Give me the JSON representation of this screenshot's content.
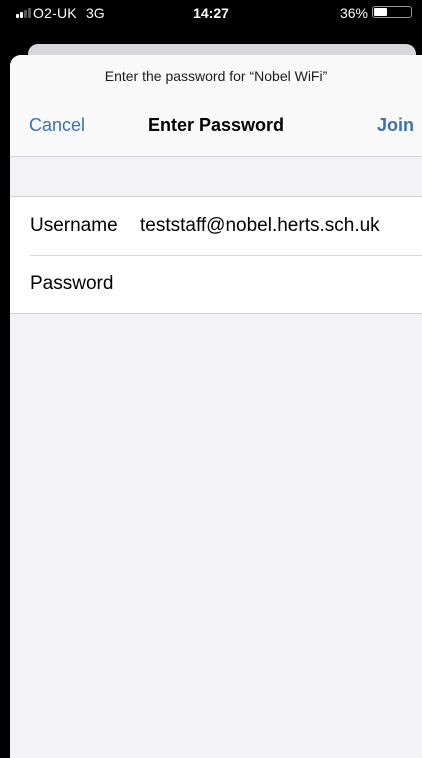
{
  "status_bar": {
    "carrier": "O2-UK",
    "network": "3G",
    "time": "14:27",
    "battery_percent_label": "36%",
    "battery_level": 0.36
  },
  "dialog": {
    "prompt": "Enter the password for “Nobel WiFi”",
    "cancel_label": "Cancel",
    "title": "Enter Password",
    "join_label": "Join"
  },
  "form": {
    "username_label": "Username",
    "username_value": "teststaff@nobel.herts.sch.uk",
    "password_label": "Password",
    "password_value": ""
  },
  "colors": {
    "accent": "#3a70b8",
    "background": "#f2f2f7"
  }
}
